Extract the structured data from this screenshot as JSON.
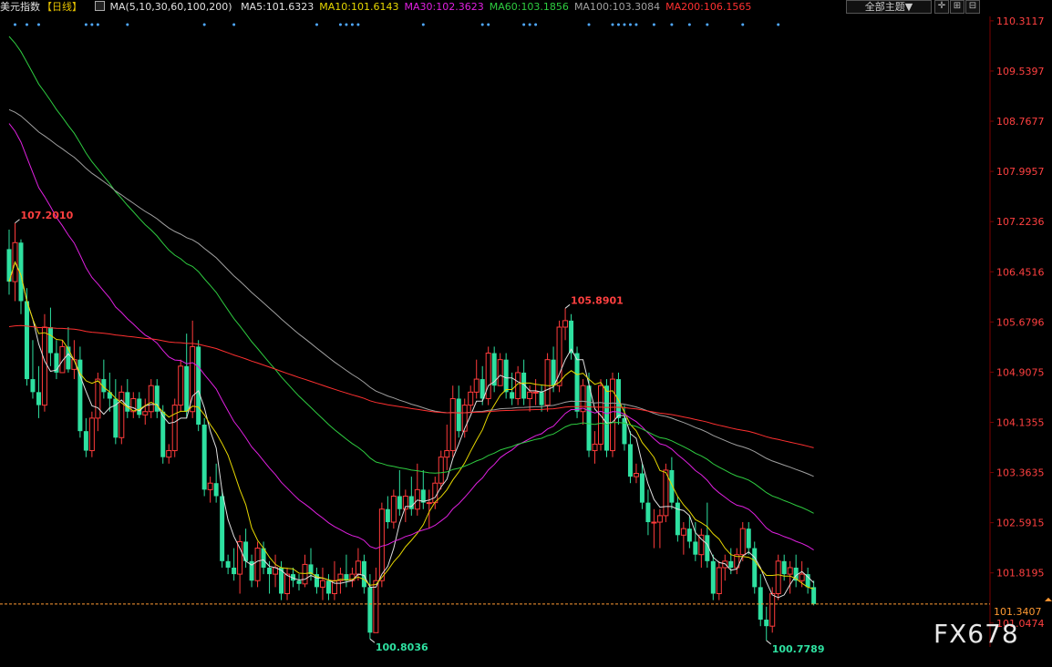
{
  "header": {
    "title": "美元指数",
    "period": "【日线】",
    "ma_params": "MA(5,10,30,60,100,200)",
    "ma_values": [
      {
        "label": "MA5:101.6323",
        "color": "#e0e0e0"
      },
      {
        "label": "MA10:101.6143",
        "color": "#e6d700"
      },
      {
        "label": "MA30:102.3623",
        "color": "#e020e0"
      },
      {
        "label": "MA60:103.1856",
        "color": "#2ecc40"
      },
      {
        "label": "MA100:103.3084",
        "color": "#a0a0a0"
      },
      {
        "label": "MA200:106.1565",
        "color": "#ff3030"
      }
    ],
    "theme_dropdown": "全部主题▼",
    "tool_icons": [
      "crosshair-icon",
      "zoom-in-icon",
      "zoom-out-icon"
    ]
  },
  "watermark": "FX678",
  "colors": {
    "up": "#ff3b3b",
    "down": "#2ee0a0",
    "price_line": "#ff9933",
    "axis_text": "#ff4040",
    "grid": "#3a0000"
  },
  "chart_data": {
    "type": "candlestick",
    "y_ticks": [
      "110.3117",
      "109.5397",
      "108.7677",
      "107.9957",
      "107.2236",
      "106.4516",
      "105.6796",
      "104.9075",
      "104.1355",
      "103.3635",
      "102.5915",
      "101.8195",
      "101.0474"
    ],
    "ylim": [
      100.68,
      110.38
    ],
    "current_price": "101.3407",
    "annotations": [
      {
        "text": "107.2010",
        "value": 107.201,
        "index": 1,
        "color": "#ff4040"
      },
      {
        "text": "105.8901",
        "value": 105.8901,
        "index": 94,
        "color": "#ff4040"
      },
      {
        "text": "100.8036",
        "value": 100.8036,
        "index": 61,
        "color": "#2ee0a0"
      },
      {
        "text": "100.7789",
        "value": 100.7789,
        "index": 128,
        "color": "#2ee0a0"
      }
    ],
    "ohlc": [
      [
        106.8,
        107.1,
        106.1,
        106.3
      ],
      [
        106.3,
        107.201,
        106.0,
        106.9
      ],
      [
        106.9,
        106.95,
        105.8,
        106.0
      ],
      [
        106.0,
        106.2,
        104.7,
        104.8
      ],
      [
        104.8,
        105.4,
        104.5,
        104.6
      ],
      [
        104.6,
        105.0,
        104.2,
        104.4
      ],
      [
        104.4,
        105.8,
        104.3,
        105.6
      ],
      [
        105.6,
        105.9,
        105.0,
        105.2
      ],
      [
        105.2,
        105.4,
        104.8,
        104.9
      ],
      [
        104.9,
        105.4,
        104.9,
        105.3
      ],
      [
        105.3,
        105.6,
        104.9,
        104.95
      ],
      [
        104.95,
        105.4,
        104.8,
        105.1
      ],
      [
        105.1,
        105.3,
        103.9,
        104.0
      ],
      [
        104.0,
        104.2,
        103.6,
        103.7
      ],
      [
        103.7,
        104.3,
        103.6,
        104.2
      ],
      [
        104.2,
        104.9,
        104.0,
        104.8
      ],
      [
        104.8,
        105.1,
        104.5,
        104.6
      ],
      [
        104.6,
        104.9,
        104.3,
        104.5
      ],
      [
        104.5,
        104.8,
        103.8,
        103.9
      ],
      [
        103.9,
        104.7,
        103.8,
        104.6
      ],
      [
        104.6,
        104.8,
        104.2,
        104.3
      ],
      [
        104.3,
        104.6,
        104.2,
        104.5
      ],
      [
        104.5,
        104.6,
        104.2,
        104.25
      ],
      [
        104.25,
        104.5,
        104.1,
        104.3
      ],
      [
        104.3,
        104.8,
        104.2,
        104.7
      ],
      [
        104.7,
        104.8,
        104.2,
        104.3
      ],
      [
        104.3,
        104.4,
        103.5,
        103.6
      ],
      [
        103.6,
        103.8,
        103.5,
        103.7
      ],
      [
        103.7,
        104.5,
        103.6,
        104.4
      ],
      [
        104.4,
        105.1,
        104.3,
        105.0
      ],
      [
        105.0,
        105.5,
        104.2,
        104.3
      ],
      [
        104.3,
        105.7,
        104.2,
        105.3
      ],
      [
        105.3,
        105.4,
        104.0,
        104.1
      ],
      [
        104.1,
        104.2,
        103.0,
        103.1
      ],
      [
        103.1,
        103.3,
        102.9,
        103.2
      ],
      [
        103.2,
        103.5,
        102.9,
        103.0
      ],
      [
        103.0,
        103.1,
        101.9,
        102.0
      ],
      [
        102.0,
        102.1,
        101.8,
        101.9
      ],
      [
        101.9,
        102.2,
        101.7,
        101.8
      ],
      [
        101.8,
        102.4,
        101.5,
        102.3
      ],
      [
        102.3,
        102.5,
        101.9,
        102.0
      ],
      [
        102.0,
        102.1,
        101.6,
        101.7
      ],
      [
        101.7,
        102.3,
        101.6,
        102.2
      ],
      [
        102.2,
        102.3,
        101.8,
        101.9
      ],
      [
        101.9,
        102.0,
        101.5,
        101.8
      ],
      [
        101.8,
        102.1,
        101.6,
        101.9
      ],
      [
        101.9,
        102.0,
        101.4,
        101.5
      ],
      [
        101.5,
        101.9,
        101.4,
        101.8
      ],
      [
        101.8,
        101.9,
        101.6,
        101.7
      ],
      [
        101.7,
        101.8,
        101.55,
        101.65
      ],
      [
        101.65,
        102.1,
        101.6,
        101.95
      ],
      [
        101.95,
        102.2,
        101.7,
        101.8
      ],
      [
        101.8,
        101.9,
        101.5,
        101.6
      ],
      [
        101.6,
        101.9,
        101.4,
        101.7
      ],
      [
        101.7,
        101.8,
        101.4,
        101.5
      ],
      [
        101.5,
        102.0,
        101.4,
        101.7
      ],
      [
        101.7,
        101.9,
        101.5,
        101.8
      ],
      [
        101.8,
        102.1,
        101.6,
        101.7
      ],
      [
        101.7,
        101.9,
        101.6,
        101.8
      ],
      [
        101.8,
        102.2,
        101.7,
        102.0
      ],
      [
        102.0,
        102.1,
        101.5,
        101.6
      ],
      [
        101.6,
        101.8,
        100.8036,
        100.9
      ],
      [
        100.9,
        101.9,
        100.9,
        101.7
      ],
      [
        101.7,
        102.9,
        101.6,
        102.8
      ],
      [
        102.8,
        103.0,
        102.5,
        102.6
      ],
      [
        102.6,
        103.1,
        102.5,
        103.0
      ],
      [
        103.0,
        103.4,
        102.7,
        102.8
      ],
      [
        102.8,
        103.1,
        102.6,
        103.0
      ],
      [
        103.0,
        103.3,
        102.7,
        102.8
      ],
      [
        102.8,
        103.5,
        102.7,
        103.1
      ],
      [
        103.1,
        103.4,
        102.8,
        102.9
      ],
      [
        102.9,
        103.1,
        102.5,
        102.9
      ],
      [
        102.9,
        103.3,
        102.8,
        103.2
      ],
      [
        103.2,
        103.7,
        103.1,
        103.6
      ],
      [
        103.6,
        104.1,
        103.4,
        103.7
      ],
      [
        103.7,
        104.7,
        103.6,
        104.5
      ],
      [
        104.5,
        104.7,
        103.9,
        104.0
      ],
      [
        104.0,
        104.5,
        103.9,
        104.4
      ],
      [
        104.4,
        104.7,
        104.3,
        104.6
      ],
      [
        104.6,
        105.1,
        104.5,
        104.8
      ],
      [
        104.8,
        105.0,
        104.4,
        104.5
      ],
      [
        104.5,
        105.3,
        104.4,
        105.2
      ],
      [
        105.2,
        105.3,
        104.6,
        104.7
      ],
      [
        104.7,
        105.2,
        104.7,
        105.1
      ],
      [
        105.1,
        105.2,
        104.5,
        104.6
      ],
      [
        104.6,
        104.9,
        104.4,
        104.5
      ],
      [
        104.5,
        105.0,
        104.4,
        104.9
      ],
      [
        104.9,
        105.1,
        104.4,
        104.5
      ],
      [
        104.5,
        104.7,
        104.3,
        104.6
      ],
      [
        104.6,
        104.8,
        104.4,
        104.6
      ],
      [
        104.6,
        104.7,
        104.3,
        104.4
      ],
      [
        104.4,
        105.2,
        104.3,
        105.1
      ],
      [
        105.1,
        105.3,
        104.6,
        104.7
      ],
      [
        104.7,
        105.7,
        104.6,
        105.6
      ],
      [
        105.6,
        105.8901,
        105.4,
        105.7
      ],
      [
        105.7,
        105.8,
        105.1,
        105.2
      ],
      [
        105.2,
        105.3,
        104.2,
        104.3
      ],
      [
        104.3,
        104.8,
        104.1,
        104.7
      ],
      [
        104.7,
        104.9,
        103.6,
        103.7
      ],
      [
        103.7,
        104.0,
        103.5,
        103.8
      ],
      [
        103.8,
        104.8,
        103.7,
        104.7
      ],
      [
        104.7,
        104.8,
        103.6,
        103.7
      ],
      [
        103.7,
        104.9,
        103.6,
        104.8
      ],
      [
        104.8,
        104.9,
        104.1,
        104.2
      ],
      [
        104.2,
        104.4,
        103.7,
        103.8
      ],
      [
        103.8,
        104.0,
        103.2,
        103.3
      ],
      [
        103.3,
        103.5,
        103.2,
        103.35
      ],
      [
        103.35,
        103.5,
        102.8,
        102.9
      ],
      [
        102.9,
        103.1,
        102.4,
        102.6
      ],
      [
        102.6,
        102.8,
        102.2,
        102.6
      ],
      [
        102.6,
        102.8,
        102.2,
        102.7
      ],
      [
        102.7,
        103.5,
        102.6,
        103.4
      ],
      [
        103.4,
        103.6,
        102.8,
        102.9
      ],
      [
        102.9,
        103.0,
        102.3,
        102.4
      ],
      [
        102.4,
        102.6,
        102.1,
        102.5
      ],
      [
        102.5,
        102.7,
        102.2,
        102.3
      ],
      [
        102.3,
        102.6,
        102.0,
        102.1
      ],
      [
        102.1,
        102.5,
        101.9,
        102.4
      ],
      [
        102.4,
        102.9,
        101.9,
        102.0
      ],
      [
        102.0,
        102.1,
        101.4,
        101.5
      ],
      [
        101.5,
        102.0,
        101.4,
        101.9
      ],
      [
        101.9,
        102.1,
        101.7,
        102.0
      ],
      [
        102.0,
        102.2,
        101.8,
        101.9
      ],
      [
        101.9,
        102.2,
        101.8,
        102.1
      ],
      [
        102.1,
        102.6,
        102.0,
        102.5
      ],
      [
        102.5,
        102.6,
        102.1,
        102.2
      ],
      [
        102.2,
        102.3,
        101.5,
        101.6
      ],
      [
        101.6,
        101.8,
        101.0,
        101.1
      ],
      [
        101.1,
        101.3,
        100.7789,
        101.0
      ],
      [
        101.0,
        101.6,
        100.9,
        101.5
      ],
      [
        101.5,
        102.1,
        101.4,
        102.0
      ],
      [
        102.0,
        102.1,
        101.7,
        101.8
      ],
      [
        101.8,
        102.0,
        101.5,
        101.9
      ],
      [
        101.9,
        102.1,
        101.6,
        101.7
      ],
      [
        101.7,
        102.0,
        101.6,
        101.8
      ],
      [
        101.8,
        101.9,
        101.5,
        101.6
      ],
      [
        101.6,
        101.7,
        101.32,
        101.3407
      ]
    ]
  }
}
